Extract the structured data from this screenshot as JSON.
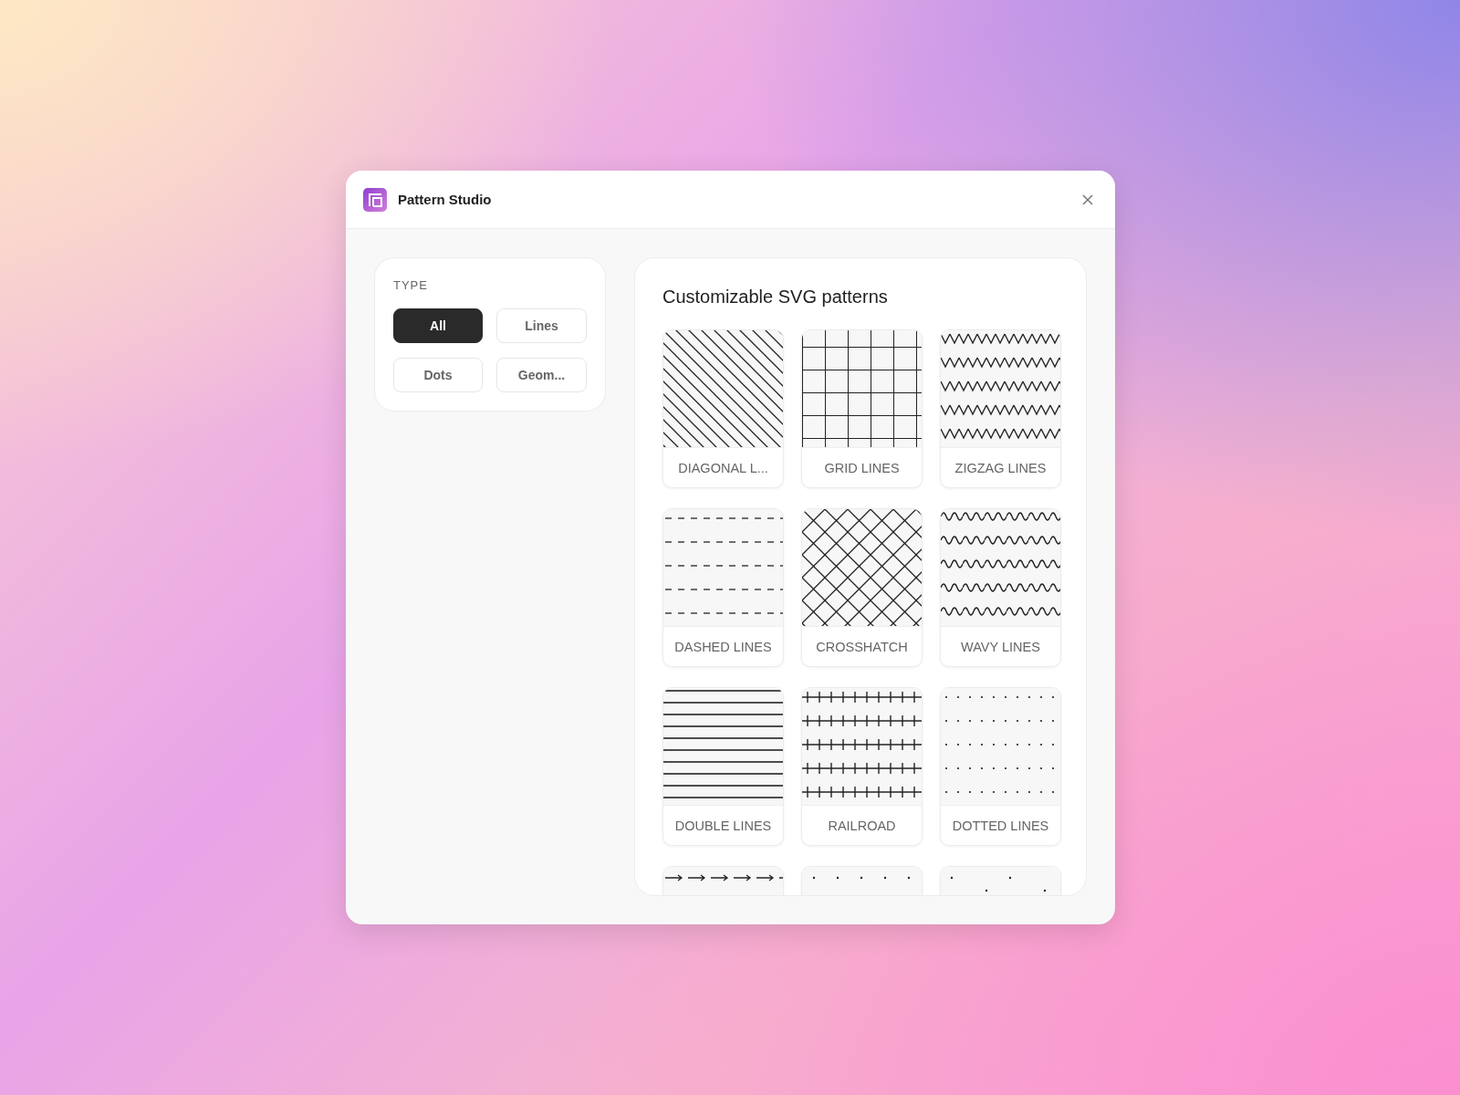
{
  "window": {
    "title": "Pattern Studio"
  },
  "filter": {
    "heading": "TYPE",
    "chips": [
      {
        "label": "All",
        "selected": true
      },
      {
        "label": "Lines",
        "selected": false
      },
      {
        "label": "Dots",
        "selected": false
      },
      {
        "label": "Geom...",
        "selected": false
      }
    ]
  },
  "gallery": {
    "title": "Customizable SVG patterns",
    "tiles": [
      {
        "kind": "diagonal",
        "label": "DIAGONAL L..."
      },
      {
        "kind": "grid",
        "label": "GRID LINES"
      },
      {
        "kind": "zigzag",
        "label": "ZIGZAG LINES"
      },
      {
        "kind": "dashed",
        "label": "DASHED LINES"
      },
      {
        "kind": "crosshatch",
        "label": "CROSSHATCH"
      },
      {
        "kind": "wavy",
        "label": "WAVY LINES"
      },
      {
        "kind": "horizontal",
        "label": "DOUBLE LINES"
      },
      {
        "kind": "railroad",
        "label": "RAILROAD"
      },
      {
        "kind": "dotted",
        "label": "DOTTED LINES"
      },
      {
        "kind": "arrows"
      },
      {
        "kind": "dots"
      },
      {
        "kind": "scatter"
      }
    ]
  }
}
